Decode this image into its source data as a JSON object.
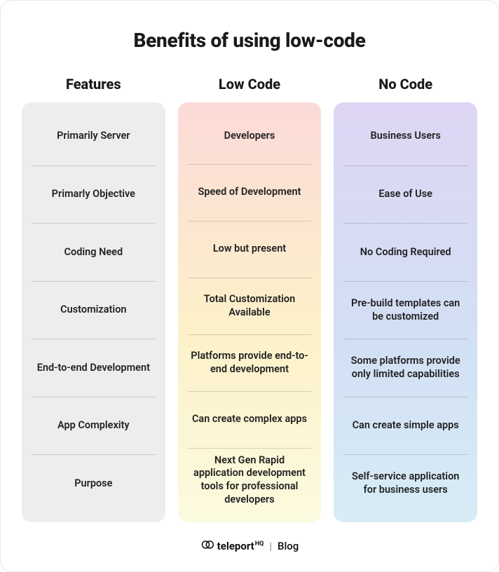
{
  "title": "Benefits of using low-code",
  "columns": {
    "features": {
      "header": "Features",
      "rows": [
        "Primarily Server",
        "Primarly Objective",
        "Coding Need",
        "Customization",
        "End-to-end Development",
        "App Complexity",
        "Purpose"
      ]
    },
    "low": {
      "header": "Low Code",
      "rows": [
        "Developers",
        "Speed of Development",
        "Low but present",
        "Total Customization Available",
        "Platforms provide end-to-end development",
        "Can create complex apps",
        "Next Gen Rapid application development tools for professional developers"
      ]
    },
    "no": {
      "header": "No Code",
      "rows": [
        "Business Users",
        "Ease of Use",
        "No Coding Required",
        "Pre-build templates can be customized",
        "Some platforms provide only limited capabilities",
        "Can create simple apps",
        "Self-service application for business users"
      ]
    }
  },
  "footer": {
    "brand": "teleport",
    "suffix": "HQ",
    "separator": "|",
    "section": "Blog"
  }
}
